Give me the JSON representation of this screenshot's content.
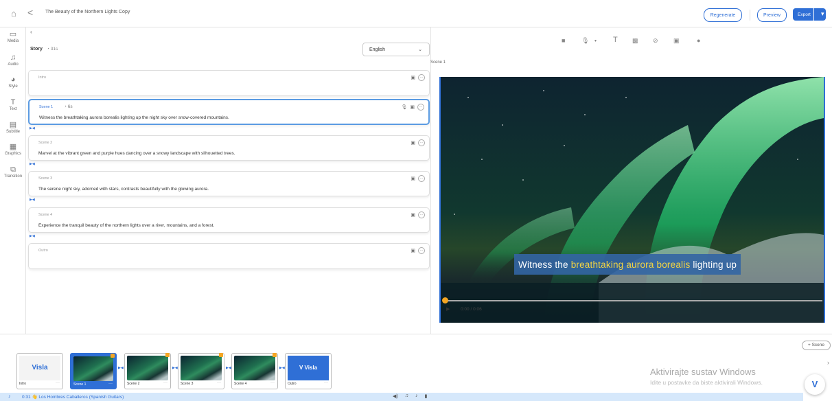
{
  "header": {
    "title": "The Beauty of the Northern Lights Copy",
    "regenerate_label": "Regenerate",
    "preview_label": "Preview",
    "export_label": "Export"
  },
  "sidebar": {
    "items": [
      {
        "label": "Media",
        "icon": "media-icon"
      },
      {
        "label": "Audio",
        "icon": "audio-icon"
      },
      {
        "label": "Style",
        "icon": "style-icon"
      },
      {
        "label": "Text",
        "icon": "text-icon"
      },
      {
        "label": "Subtitle",
        "icon": "subtitle-icon"
      },
      {
        "label": "Graphics",
        "icon": "graphics-icon"
      },
      {
        "label": "Transition",
        "icon": "transition-icon"
      }
    ]
  },
  "story": {
    "title": "Story",
    "duration": "31s",
    "language": "English",
    "cards": [
      {
        "label": "Intro",
        "duration": "",
        "text": ""
      },
      {
        "label": "Scene 1",
        "duration": "6s",
        "text": "Witness the breathtaking aurora borealis lighting up the night sky over snow-covered mountains."
      },
      {
        "label": "Scene 2",
        "duration": "",
        "text": "Marvel at the vibrant green and purple hues dancing over a snowy landscape with silhouetted trees."
      },
      {
        "label": "Scene 3",
        "duration": "",
        "text": "The serene night sky, adorned with stars, contrasts beautifully with the glowing aurora."
      },
      {
        "label": "Scene 4",
        "duration": "",
        "text": "Experience the tranquil beauty of the northern lights over a river, mountains, and a forest."
      },
      {
        "label": "Outro",
        "duration": "",
        "text": ""
      }
    ]
  },
  "preview": {
    "scene_label": "Scene 1",
    "caption_pre": "Witness the",
    "caption_hl": "breathtaking aurora borealis",
    "caption_post": "lighting up",
    "time": "0:00 / 0:06",
    "progress": 0.0
  },
  "timeline": {
    "add_scene_label": "+ Scene",
    "thumbs": [
      {
        "label": "Intro",
        "kind": "visla-white",
        "text": "Visla"
      },
      {
        "label": "Scene 1",
        "kind": "image",
        "selected": true
      },
      {
        "label": "Scene 2",
        "kind": "image"
      },
      {
        "label": "Scene 3",
        "kind": "image"
      },
      {
        "label": "Scene 4",
        "kind": "image"
      },
      {
        "label": "Outro",
        "kind": "visla-blue",
        "text": "V Visla"
      }
    ]
  },
  "audio": {
    "label": "0:31 👋 Los Hombres Caballeros (Spanish Guitars)"
  },
  "windows": {
    "line1": "Aktivirajte sustav Windows",
    "line2": "Idite u postavke da biste aktivirali Windows."
  },
  "colors": {
    "accent": "#2f6fd6",
    "caption_bg": "#3365a3",
    "caption_highlight": "#f2d443"
  }
}
